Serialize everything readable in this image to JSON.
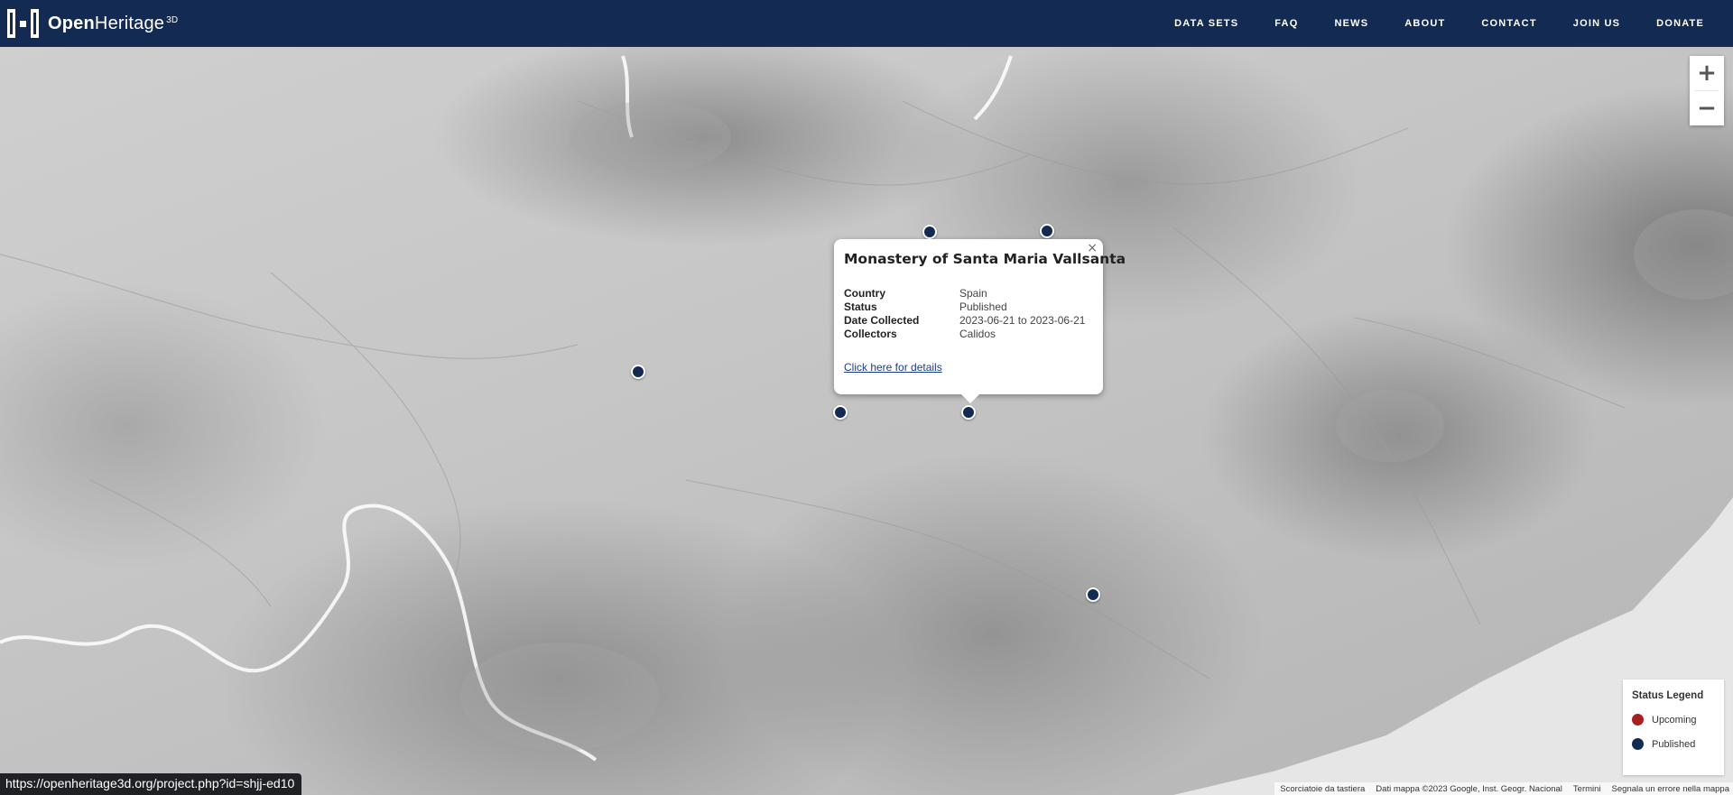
{
  "brand": {
    "name_bold": "Open",
    "name_rest": "Heritage",
    "superscript": "3D"
  },
  "nav": [
    {
      "label": "DATA SETS"
    },
    {
      "label": "FAQ"
    },
    {
      "label": "NEWS"
    },
    {
      "label": "ABOUT"
    },
    {
      "label": "CONTACT"
    },
    {
      "label": "JOIN US"
    },
    {
      "label": "DONATE"
    }
  ],
  "zoom": {
    "in_label": "+",
    "out_label": "−"
  },
  "popup": {
    "title": "Monastery of Santa Maria Vallsanta",
    "close_label": "×",
    "rows": [
      {
        "key": "Country",
        "value": "Spain"
      },
      {
        "key": "Status",
        "value": "Published"
      },
      {
        "key": "Date Collected",
        "value": "2023-06-21 to 2023-06-21"
      },
      {
        "key": "Collectors",
        "value": "Calidos"
      }
    ],
    "link": "Click here for details"
  },
  "legend": {
    "title": "Status Legend",
    "items": [
      {
        "label": "Upcoming",
        "color": "#a81f1f"
      },
      {
        "label": "Published",
        "color": "#132a52"
      }
    ]
  },
  "attribution": [
    "Scorciatoie da tastiera",
    "Dati mappa ©2023 Google, Inst. Geogr. Nacional",
    "Termini",
    "Segnala un errore nella mappa"
  ],
  "status_url": "https://openheritage3d.org/project.php?id=shjj-ed10",
  "colors": {
    "header": "#132a52",
    "marker_published": "#132a52",
    "marker_upcoming": "#a81f1f"
  }
}
